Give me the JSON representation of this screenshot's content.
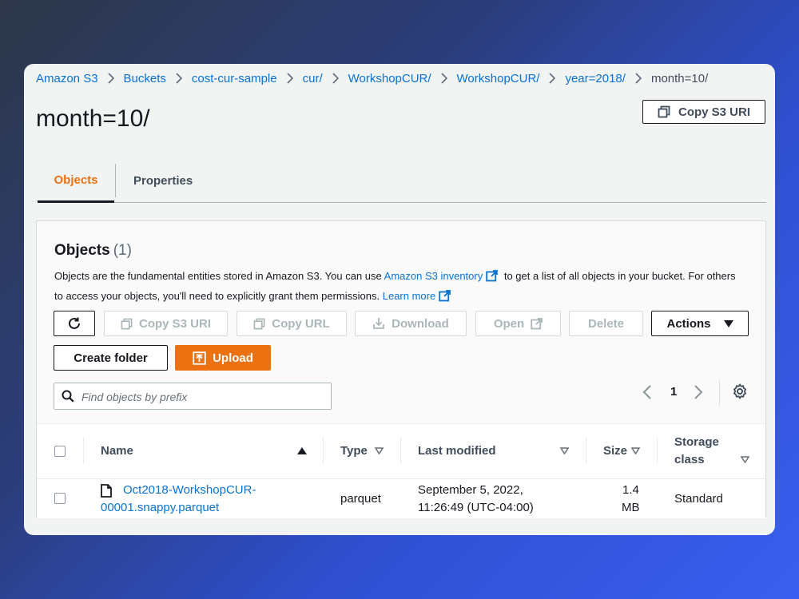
{
  "breadcrumb": {
    "items": [
      "Amazon S3",
      "Buckets",
      "cost-cur-sample",
      "cur/",
      "WorkshopCUR/",
      "WorkshopCUR/",
      "year=2018/"
    ],
    "current": "month=10/"
  },
  "page_title": "month=10/",
  "copy_s3_uri_label": "Copy S3 URI",
  "tabs": [
    "Objects",
    "Properties"
  ],
  "active_tab": "Objects",
  "objects_panel": {
    "title": "Objects",
    "count": "(1)",
    "desc_part1": "Objects are the fundamental entities stored in Amazon S3. You can use ",
    "inventory_link": "Amazon S3 inventory",
    "desc_part2": " to get a list of all objects in your bucket. For others to access your objects, you'll need to explicitly grant them permissions. ",
    "learn_more": "Learn more"
  },
  "toolbar": {
    "refresh_icon": "refresh-icon",
    "copy_s3_uri": "Copy S3 URI",
    "copy_url": "Copy URL",
    "download": "Download",
    "open": "Open",
    "delete": "Delete",
    "actions": "Actions",
    "create_folder": "Create folder",
    "upload": "Upload"
  },
  "search": {
    "placeholder": "Find objects by prefix"
  },
  "pagination": {
    "page": "1"
  },
  "table": {
    "headers": {
      "name": "Name",
      "type": "Type",
      "last_modified": "Last modified",
      "size": "Size",
      "storage_line1": "Storage",
      "storage_line2": "class"
    },
    "rows": [
      {
        "name_line1": "Oct2018-WorkshopCUR-",
        "name_line2": "00001.snappy.parquet",
        "type": "parquet",
        "modified_line1": "September 5, 2022,",
        "modified_line2": "11:26:49 (UTC-04:00)",
        "size_line1": "1.4",
        "size_line2": "MB",
        "storage_class": "Standard"
      }
    ]
  },
  "colors": {
    "accent": "#ec7211",
    "link": "#0972d3",
    "text": "#16191f",
    "muted": "#414d5c"
  }
}
